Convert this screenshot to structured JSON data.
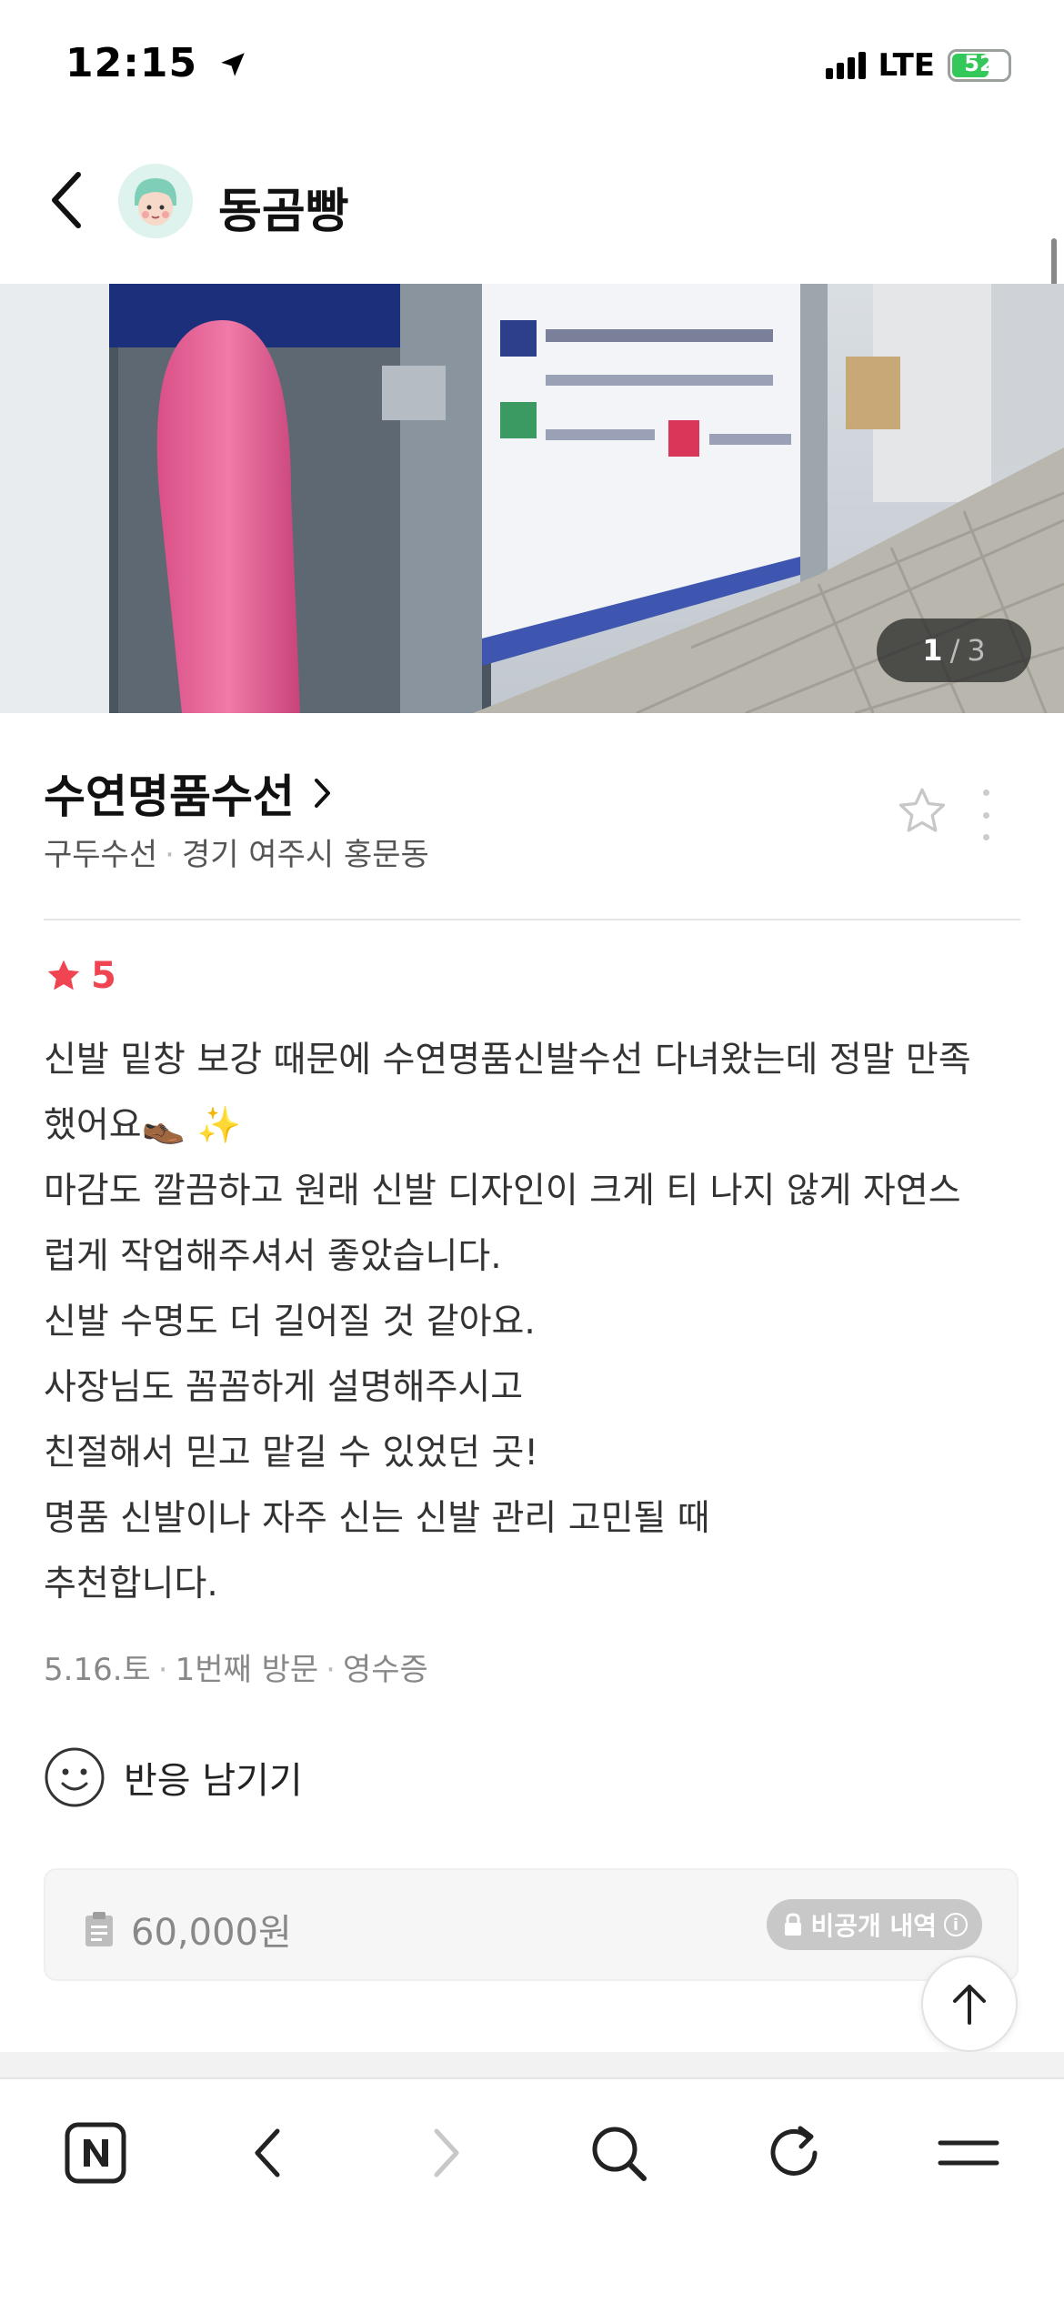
{
  "status_bar": {
    "time": "12:15",
    "network": "LTE",
    "battery": "52",
    "battery_level": 0.52
  },
  "header": {
    "title": "동곰빵",
    "back_icon": "chevron-left-icon",
    "avatar_icon": "avatar-icon"
  },
  "photo": {
    "counter_current": "1",
    "counter_separator": "/",
    "counter_total": "3"
  },
  "place": {
    "name": "수연명품수선",
    "category": "구두수선",
    "location": "경기 여주시 홍문동",
    "chevron_icon": "chevron-right-icon",
    "star_icon": "star-outline-icon",
    "more_icon": "more-vertical-icon"
  },
  "review": {
    "rating": "5",
    "lines": [
      "신발 밑창 보강 때문에 수연명품신발수선 다녀왔는데 정말 만족",
      "했어요👞 ✨",
      "마감도 깔끔하고 원래 신발 디자인이 크게 티 나지 않게 자연스",
      "럽게 작업해주셔서 좋았습니다.",
      "신발 수명도 더 길어질 것 같아요.",
      "사장님도 꼼꼼하게 설명해주시고",
      "친절해서 믿고 맡길 수 있었던 곳!",
      "명품 신발이나 자주 신는 신발 관리 고민될 때",
      "추천합니다."
    ],
    "date": "5.16.토",
    "visit": "1번째 방문",
    "proof": "영수증"
  },
  "reaction": {
    "label": "반응 남기기"
  },
  "receipt": {
    "price": "60,000원",
    "private_label": "비공개 내역",
    "info_symbol": "i"
  },
  "colors": {
    "accent_red": "#f04452",
    "battery_green": "#34c759",
    "text_gray": "#888888"
  },
  "toolbar": {
    "icons": [
      "naver-home-icon",
      "back-arrow-icon",
      "forward-arrow-icon",
      "search-icon",
      "reload-icon",
      "menu-icon"
    ]
  }
}
